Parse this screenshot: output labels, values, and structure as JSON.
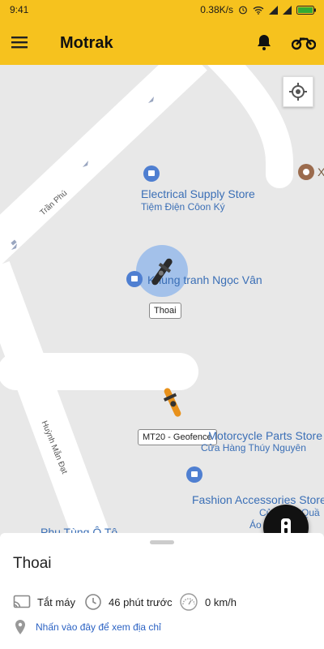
{
  "status_bar": {
    "time": "9:41",
    "network_speed": "0.38K/s",
    "icons": [
      "alarm-icon",
      "wifi-icon",
      "signal-icon",
      "signal-icon",
      "battery-icon"
    ]
  },
  "app_bar": {
    "title": "Motrak",
    "icons": [
      "menu-icon",
      "bell-icon",
      "motorcycle-icon"
    ]
  },
  "map": {
    "streets": [
      "Trần Phú",
      "Huỳnh Mẫn Đạt"
    ],
    "places": [
      {
        "name": "Electrical Supply Store",
        "sub": "Tiệm Điện Côon Ký"
      },
      {
        "name": "Khung tranh Ngọc Vân"
      },
      {
        "name": "Motorcycle Parts Store",
        "sub": "Cửa Hàng Thúy Nguyên"
      },
      {
        "name": "Fashion Accessories Store",
        "sub": "Cử",
        "sub2": "Quầ",
        "sub3": "Áo"
      },
      {
        "name": "Phụ Tùng Ô Tô"
      },
      {
        "name": "X"
      }
    ],
    "markers": [
      {
        "label": "Thoai",
        "icon": "motorcycle-marker-icon"
      },
      {
        "label": "MT20 - Geofence",
        "icon": "motorcycle-marker-icon"
      }
    ],
    "locate_icon": "crosshair-icon"
  },
  "fab": {
    "icon": "remote-control-icon",
    "accent": "#111111"
  },
  "sheet": {
    "vehicle_name": "Thoai",
    "engine_status": "Tắt máy",
    "last_update": "46 phút trước",
    "speed": "0 km/h",
    "address_link": "Nhấn vào đây để xem địa chỉ",
    "icons": [
      "cast-icon",
      "clock-icon",
      "speedometer-icon",
      "location-pin-icon"
    ]
  },
  "colors": {
    "brand": "#f6c21e",
    "link": "#2b62c3",
    "map_label": "#3b6fb6"
  }
}
